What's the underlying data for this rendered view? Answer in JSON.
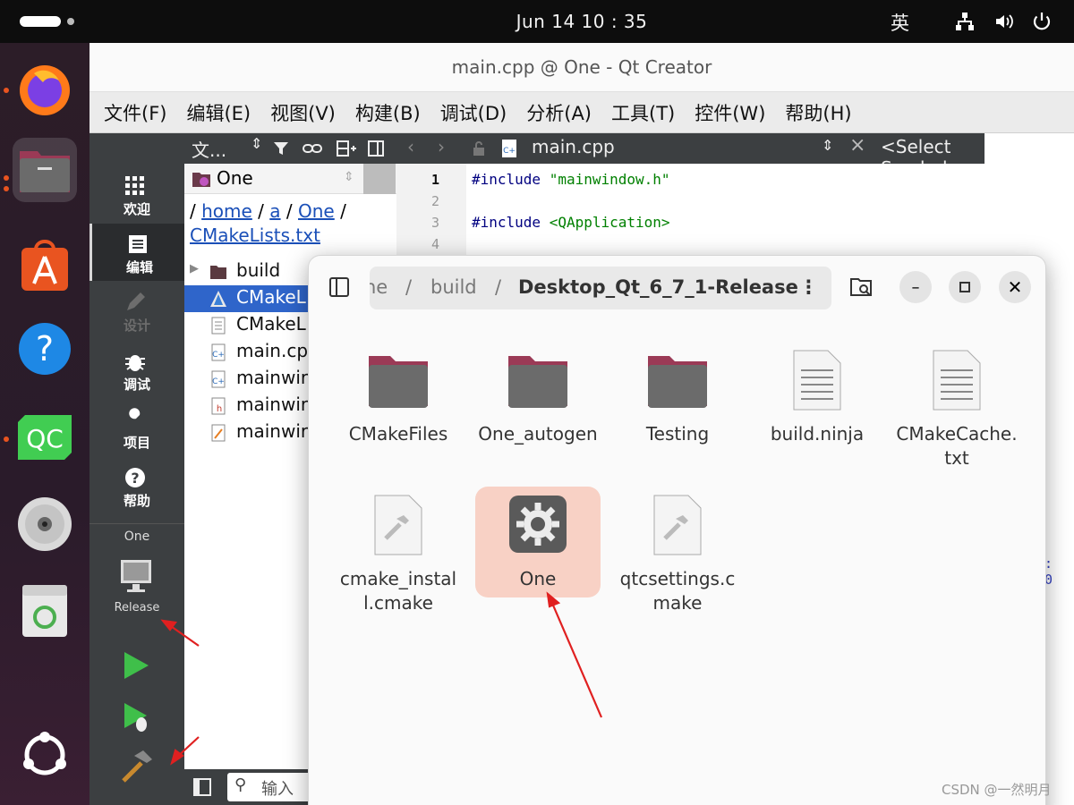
{
  "topbar": {
    "datetime": "Jun 14  10 : 35",
    "ime": "英"
  },
  "qt": {
    "window_title": "main.cpp @ One - Qt Creator",
    "menu": [
      "文件(F)",
      "编辑(E)",
      "视图(V)",
      "构建(B)",
      "调试(D)",
      "分析(A)",
      "工具(T)",
      "控件(W)",
      "帮助(H)"
    ],
    "modes": [
      "欢迎",
      "编辑",
      "设计",
      "调试",
      "项目",
      "帮助"
    ],
    "kit_project": "One",
    "kit_config": "Release",
    "panel_title": "文...",
    "project_selector": "One",
    "breadcrumb": [
      "home",
      "a",
      "One",
      "CMakeLists.txt"
    ],
    "tree": [
      "build",
      "CMakeL",
      "CMakeL",
      "main.cp",
      "mainwir",
      "mainwir",
      "mainwir"
    ],
    "editor_file": "main.cpp",
    "symbol_selector": "<Select Symbol>",
    "line_numbers": [
      "1",
      "2",
      "3",
      "4"
    ],
    "code": [
      {
        "kw": "#include",
        "str": " \"mainwindow.h\""
      },
      {
        "kw": "",
        "str": ""
      },
      {
        "kw": "#include",
        "str": " <QApplication>"
      }
    ],
    "locator_placeholder": "输入",
    "partial_edge_text": ": 0"
  },
  "files": {
    "path": [
      "ne",
      "build",
      "Desktop_Qt_6_7_1-Release"
    ],
    "items": [
      {
        "name": "CMakeFiles",
        "type": "folder"
      },
      {
        "name": "One_autogen",
        "type": "folder"
      },
      {
        "name": "Testing",
        "type": "folder"
      },
      {
        "name": "build.ninja",
        "type": "text"
      },
      {
        "name": "CMakeCache.txt",
        "type": "text"
      },
      {
        "name": "cmake_install.cmake",
        "type": "script"
      },
      {
        "name": "One",
        "type": "executable"
      },
      {
        "name": "qtcsettings.cmake",
        "type": "script"
      }
    ]
  },
  "watermark": "CSDN @一然明月",
  "colors": {
    "accent": "#e95420",
    "selection": "#2f65ca",
    "file_selected": "#f8d1c5",
    "annotation": "#e02020"
  }
}
